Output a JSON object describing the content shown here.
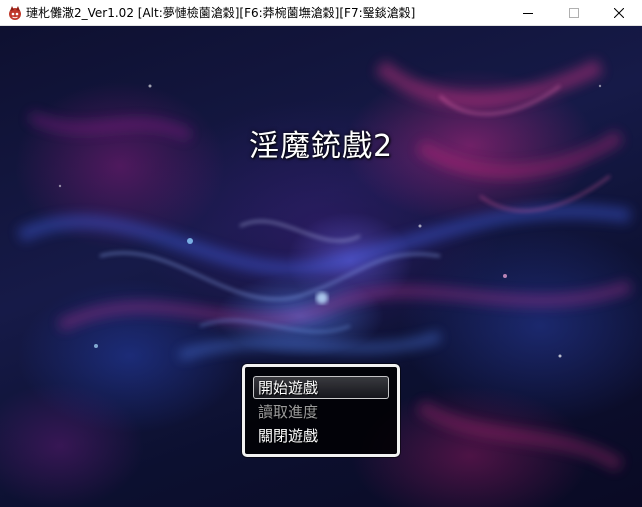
{
  "window": {
    "title": "璉朼儺潵2_Ver1.02 [Alt:夢慩檢薗滄穀][F6:莽椀薗墲滄穀][F7:瑿錟滄穀]",
    "buttons": [
      "minimize",
      "maximize",
      "close"
    ],
    "icon": "game-app-icon"
  },
  "game": {
    "title": "淫魔銃戲2"
  },
  "menu": {
    "items": [
      {
        "label": "開始遊戲",
        "selected": true,
        "enabled": true
      },
      {
        "label": "讀取進度",
        "selected": false,
        "enabled": false
      },
      {
        "label": "關閉遊戲",
        "selected": false,
        "enabled": true
      }
    ]
  },
  "colors": {
    "titlebar_bg": "#ffffff",
    "menu_border": "#f2f2f2",
    "menu_bg": "#000000",
    "disabled_text": "#9a9a9a",
    "nebula_magenta": "#dc288c",
    "nebula_blue": "#3c64d2"
  }
}
